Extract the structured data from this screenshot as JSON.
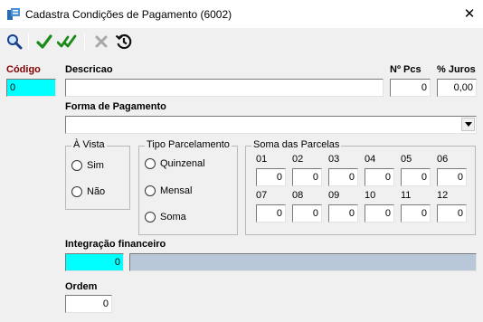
{
  "window": {
    "title": "Cadastra Condições de Pagamento (6002)",
    "close_glyph": "✕"
  },
  "toolbar": {
    "buttons": [
      {
        "name": "search",
        "icon": "magnifier-icon"
      },
      {
        "name": "confirm",
        "icon": "check-icon"
      },
      {
        "name": "confirm-all",
        "icon": "double-check-icon"
      },
      {
        "name": "cancel",
        "icon": "x-icon"
      },
      {
        "name": "history",
        "icon": "history-icon"
      }
    ]
  },
  "form": {
    "codigo": {
      "label": "Código",
      "value": "0"
    },
    "descricao": {
      "label": "Descricao",
      "value": ""
    },
    "num_pcs": {
      "label": "Nº Pcs",
      "value": "0"
    },
    "pct_juros": {
      "label": "% Juros",
      "value": "0,00"
    },
    "forma_pagamento": {
      "label": "Forma de Pagamento",
      "value": ""
    },
    "a_vista": {
      "title": "À Vista",
      "options": [
        "Sim",
        "Não"
      ]
    },
    "tipo_parcelamento": {
      "title": "Tipo Parcelamento",
      "options": [
        "Quinzenal",
        "Mensal",
        "Soma"
      ]
    },
    "soma_parcelas": {
      "title": "Soma das Parcelas",
      "parcelas": [
        {
          "label": "01",
          "value": "0"
        },
        {
          "label": "02",
          "value": "0"
        },
        {
          "label": "03",
          "value": "0"
        },
        {
          "label": "04",
          "value": "0"
        },
        {
          "label": "05",
          "value": "0"
        },
        {
          "label": "06",
          "value": "0"
        },
        {
          "label": "07",
          "value": "0"
        },
        {
          "label": "08",
          "value": "0"
        },
        {
          "label": "09",
          "value": "0"
        },
        {
          "label": "10",
          "value": "0"
        },
        {
          "label": "11",
          "value": "0"
        },
        {
          "label": "12",
          "value": "0"
        }
      ]
    },
    "integracao": {
      "label": "Integração financeiro",
      "value": "0",
      "description": ""
    },
    "ordem": {
      "label": "Ordem",
      "value": "0"
    }
  },
  "colors": {
    "codigo_label": "#800000",
    "highlight_field": "#00ffff",
    "readonly_field": "#b8c8d8",
    "check_green": "#1a8a1a"
  }
}
